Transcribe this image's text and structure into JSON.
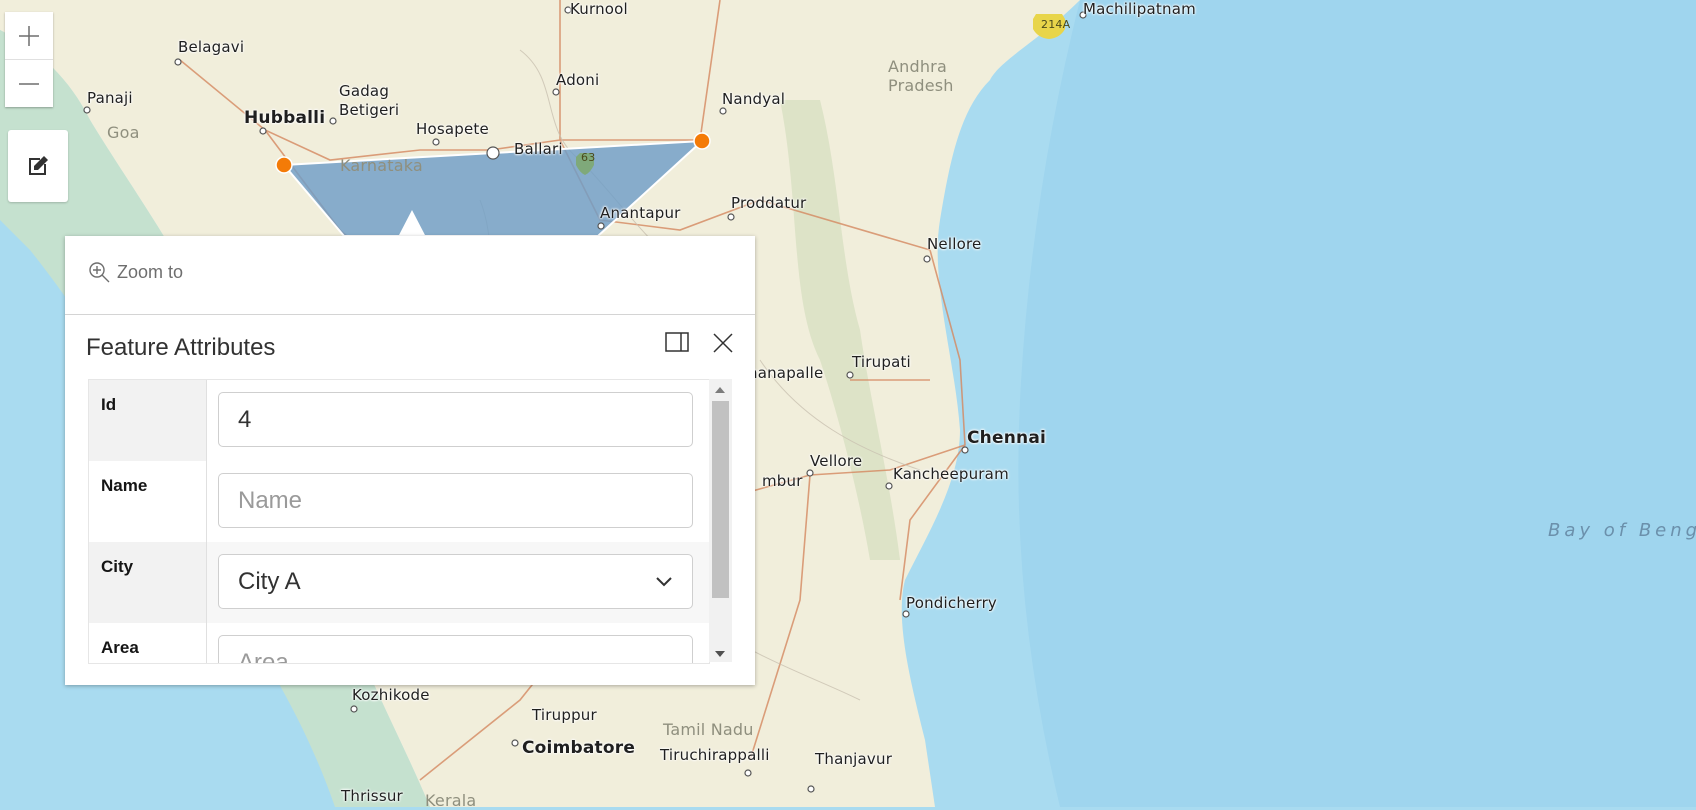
{
  "zoom_controls": {
    "zoom_in_icon": "plus-icon",
    "zoom_out_icon": "minus-icon"
  },
  "edit_button": {
    "icon": "edit-icon"
  },
  "map": {
    "labels": [
      {
        "text": "Belagavi",
        "cls": ""
      },
      {
        "text": "Panaji",
        "cls": ""
      },
      {
        "text": "Goa",
        "cls": "region"
      },
      {
        "text": "Hubballi",
        "cls": "big"
      },
      {
        "text": "Gadag",
        "cls": ""
      },
      {
        "text": "Betigeri",
        "cls": ""
      },
      {
        "text": "Hosapete",
        "cls": ""
      },
      {
        "text": "Ballari",
        "cls": ""
      },
      {
        "text": "Adoni",
        "cls": ""
      },
      {
        "text": "Nandyal",
        "cls": ""
      },
      {
        "text": "Karnataka",
        "cls": "region"
      },
      {
        "text": "Anantapur",
        "cls": ""
      },
      {
        "text": "Proddatur",
        "cls": ""
      },
      {
        "text": "Andhra",
        "cls": "region"
      },
      {
        "text": "Pradesh",
        "cls": "region"
      },
      {
        "text": "Nellore",
        "cls": ""
      },
      {
        "text": "Machilipatnam",
        "cls": ""
      },
      {
        "text": "Tirupati",
        "cls": ""
      },
      {
        "text": "Chennai",
        "cls": "big"
      },
      {
        "text": "Vellore",
        "cls": ""
      },
      {
        "text": "Kancheepuram",
        "cls": ""
      },
      {
        "text": "Pondicherry",
        "cls": ""
      },
      {
        "text": "Kozhikode",
        "cls": ""
      },
      {
        "text": "Tiruppur",
        "cls": ""
      },
      {
        "text": "Coimbatore",
        "cls": "big"
      },
      {
        "text": "Tamil Nadu",
        "cls": "region"
      },
      {
        "text": "Tiruchirappalli",
        "cls": ""
      },
      {
        "text": "Thanjavur",
        "cls": ""
      },
      {
        "text": "Thrissur",
        "cls": ""
      },
      {
        "text": "Kerala",
        "cls": "region"
      },
      {
        "text": "nanapalle",
        "cls": ""
      },
      {
        "text": "mbur",
        "cls": ""
      },
      {
        "text": "Bay of Beng",
        "cls": "sea"
      },
      {
        "text": "Kurnool",
        "cls": ""
      }
    ],
    "shields": [
      "63",
      "214A"
    ]
  },
  "popup": {
    "zoom_to_label": "Zoom to",
    "title": "Feature Attributes",
    "fields": [
      {
        "key": "Id",
        "value": "4",
        "placeholder": ""
      },
      {
        "key": "Name",
        "value": "",
        "placeholder": "Name"
      },
      {
        "key": "City",
        "value": "City A",
        "placeholder": ""
      },
      {
        "key": "Area",
        "value": "",
        "placeholder": "Area"
      }
    ]
  },
  "colors": {
    "water": "#a9dbf0",
    "land": "#f1eedb",
    "polygon_fill": "#6f9dc7",
    "vertex": "#f47b07"
  }
}
